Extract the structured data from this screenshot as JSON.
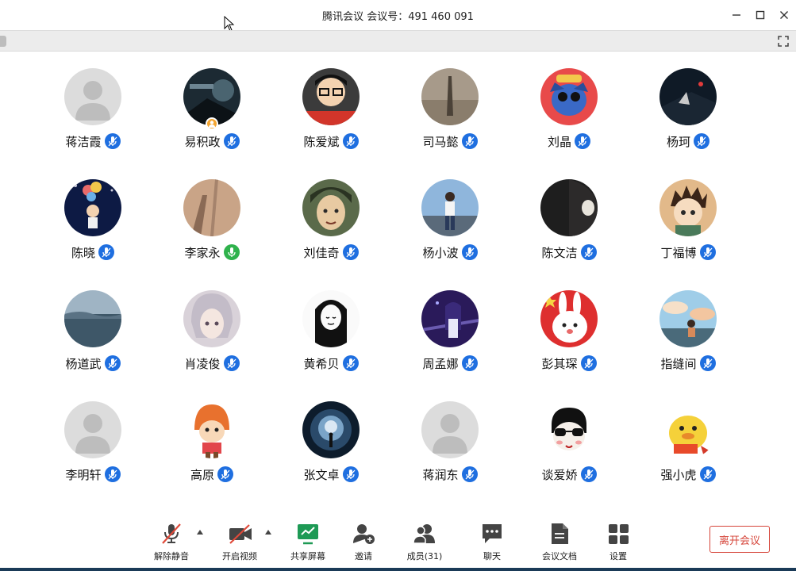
{
  "window": {
    "title": "腾讯会议 会议号：491 460 091",
    "controls": [
      "minimize",
      "maximize",
      "close"
    ]
  },
  "participants": [
    {
      "name": "蒋洁霞",
      "avatar": "default",
      "mic": "muted"
    },
    {
      "name": "易积政",
      "avatar": "dark-poster",
      "mic": "muted",
      "host": true
    },
    {
      "name": "陈爱斌",
      "avatar": "cartoon-glasses",
      "mic": "muted"
    },
    {
      "name": "司马懿",
      "avatar": "shadow-road",
      "mic": "muted"
    },
    {
      "name": "刘晶",
      "avatar": "stitch",
      "mic": "muted"
    },
    {
      "name": "杨珂",
      "avatar": "dark-night",
      "mic": "muted"
    },
    {
      "name": "陈晓",
      "avatar": "balloon-girl",
      "mic": "muted"
    },
    {
      "name": "李家永",
      "avatar": "shadow-wall",
      "mic": "active"
    },
    {
      "name": "刘佳奇",
      "avatar": "anime-green",
      "mic": "muted"
    },
    {
      "name": "杨小波",
      "avatar": "man-sky",
      "mic": "muted"
    },
    {
      "name": "陈文洁",
      "avatar": "dark-mask",
      "mic": "muted"
    },
    {
      "name": "丁福博",
      "avatar": "anime-boy",
      "mic": "muted"
    },
    {
      "name": "杨道武",
      "avatar": "sea-view",
      "mic": "muted"
    },
    {
      "name": "肖凌俊",
      "avatar": "anime-silver",
      "mic": "muted"
    },
    {
      "name": "黄希贝",
      "avatar": "sketch-girl",
      "mic": "muted"
    },
    {
      "name": "周孟娜",
      "avatar": "purple-night",
      "mic": "muted"
    },
    {
      "name": "彭其琛",
      "avatar": "rabbit-flag",
      "mic": "muted"
    },
    {
      "name": "指缝间",
      "avatar": "sunset-girl",
      "mic": "muted"
    },
    {
      "name": "李明轩",
      "avatar": "default",
      "mic": "muted"
    },
    {
      "name": "高原",
      "avatar": "orange-kid",
      "mic": "muted"
    },
    {
      "name": "张文卓",
      "avatar": "tunnel",
      "mic": "muted"
    },
    {
      "name": "蒋润东",
      "avatar": "default",
      "mic": "muted"
    },
    {
      "name": "谈爱娇",
      "avatar": "sunglasses",
      "mic": "muted"
    },
    {
      "name": "强小虎",
      "avatar": "duck",
      "mic": "muted"
    }
  ],
  "toolbar": {
    "unmute": "解除静音",
    "start_video": "开启视频",
    "share_screen": "共享屏幕",
    "invite": "邀请",
    "members": "成员(31)",
    "chat": "聊天",
    "docs": "会议文档",
    "settings": "设置",
    "leave": "离开会议"
  },
  "colors": {
    "mic_muted": "#1f6fe0",
    "mic_active": "#2fb24c",
    "leave": "#d6453a",
    "share": "#1e9a55"
  }
}
